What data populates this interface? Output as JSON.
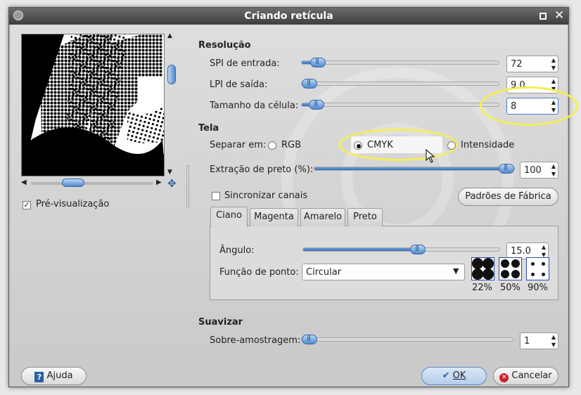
{
  "title": "Criando retícula",
  "preview": {
    "checkbox_label": "Pré-visualização",
    "checked": true
  },
  "resolution": {
    "heading": "Resolução",
    "spi": {
      "label": "SPI de entrada:",
      "value": "72",
      "fraction": 0.1
    },
    "lpi": {
      "label": "LPI de saída:",
      "value": "9.0",
      "fraction": 0.04
    },
    "cell": {
      "label": "Tamanho da célula:",
      "value": "8",
      "fraction": 0.08
    }
  },
  "screen": {
    "heading": "Tela",
    "separate_label": "Separar em:",
    "options": [
      "RGB",
      "CMYK",
      "Intensidade"
    ],
    "selected": "CMYK",
    "black_extraction": {
      "label": "Extração de preto (%):",
      "value": "100",
      "fraction": 1.0
    },
    "sync_label": "Sincronizar canais",
    "defaults_button": "Padrões de Fábrica"
  },
  "tabs": [
    "Ciano",
    "Magenta",
    "Amarelo",
    "Preto"
  ],
  "active_tab": "Ciano",
  "angle": {
    "label": "Ângulo:",
    "value": "15.0",
    "fraction": 0.58
  },
  "spot": {
    "label": "Função de ponto:",
    "value": "Circular",
    "previews": [
      "22%",
      "50%",
      "90%"
    ]
  },
  "smooth": {
    "heading": "Suavizar",
    "oversample_label": "Sobre-amostragem:",
    "value": "1",
    "fraction": 0.0
  },
  "buttons": {
    "help": "Ajuda",
    "ok": "OK",
    "cancel": "Cancelar"
  }
}
